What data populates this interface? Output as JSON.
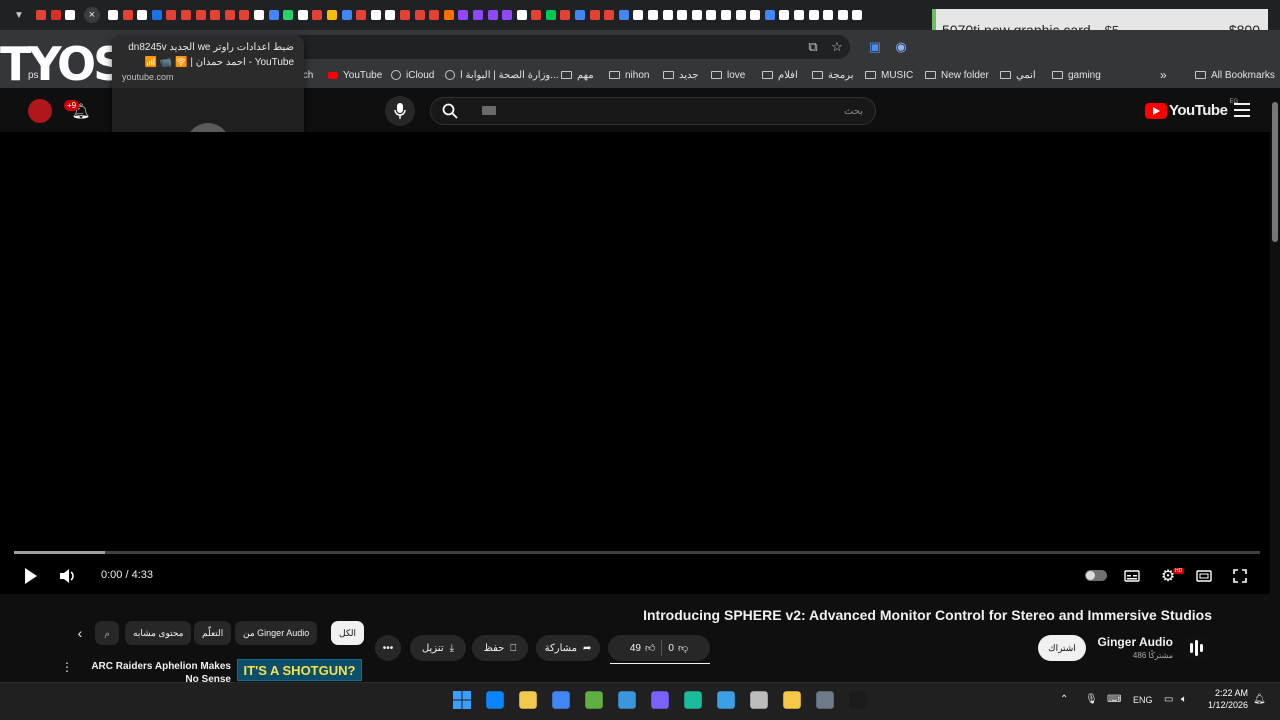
{
  "browser": {
    "tab_favicon_colors": [
      "#e44134",
      "#d93025",
      "#ffffff",
      "#ffffff",
      "#e44134",
      "#ffffff",
      "#1a73e8",
      "#e44134",
      "#e44134",
      "#e44134",
      "#e44134",
      "#e44134",
      "#e44134",
      "#ffffff",
      "#4285f4",
      "#25d366",
      "#ffffff",
      "#e44134",
      "#fbbc04",
      "#4285f4",
      "#e44134",
      "#ffffff",
      "#ffffff",
      "#e44134",
      "#e44134",
      "#e44134",
      "#ff6f00",
      "#9146ff",
      "#9146ff",
      "#9146ff",
      "#9146ff",
      "#ffffff",
      "#e44134",
      "#00c853",
      "#e44134",
      "#4285f4",
      "#e44134",
      "#e44134",
      "#4285f4",
      "#ffffff",
      "#ffffff",
      "#ffffff",
      "#ffffff",
      "#ffffff",
      "#ffffff",
      "#ffffff",
      "#ffffff",
      "#ffffff",
      "#4285f4",
      "#ffffff",
      "#ffffff",
      "#ffffff",
      "#ffffff",
      "#ffffff",
      "#ffffff"
    ],
    "active_tab_close": "×",
    "hovercard": {
      "title": "ضبط اعدادات راوتر we الجديد dn8245v YouTube - احمد حمدان | 🛜 📹 📶",
      "domain": "youtube.com"
    },
    "bookmarks": [
      {
        "label": "ps",
        "icon": "apps-icon"
      },
      {
        "label": "tch",
        "icon": "globe"
      },
      {
        "label": "YouTube",
        "icon": "youtube"
      },
      {
        "label": "iCloud",
        "icon": "globe"
      },
      {
        "label": "وزارة الصحة | البوابة ا...",
        "icon": "globe"
      },
      {
        "label": "مهم",
        "icon": "folder"
      },
      {
        "label": "nihon",
        "icon": "folder"
      },
      {
        "label": "جديد",
        "icon": "folder"
      },
      {
        "label": "love",
        "icon": "folder"
      },
      {
        "label": "افلام",
        "icon": "folder"
      },
      {
        "label": "برمجة",
        "icon": "folder"
      },
      {
        "label": "MUSIC",
        "icon": "folder"
      },
      {
        "label": "New folder",
        "icon": "folder"
      },
      {
        "label": "انمي",
        "icon": "folder"
      },
      {
        "label": "gaming",
        "icon": "folder"
      }
    ],
    "more_bookmarks": "»",
    "all_bookmarks": "All Bookmarks"
  },
  "price_widget": {
    "name": "5070ti new graphic card",
    "low": "$5",
    "high": "$800"
  },
  "overlay_logo": "TYOS",
  "youtube": {
    "search_placeholder": "بحث",
    "logo_text": "YouTube",
    "country_code": "EG",
    "notifications_badge": "+9",
    "player": {
      "time": "0:00 / 4:33",
      "progress_buffered": 0.073
    },
    "video_title": "Introducing SPHERE v2: Advanced Monitor Control for Stereo and Immersive Studios",
    "channel": {
      "name": "Ginger Audio",
      "subscribers": "486 مشتركًا",
      "subscribe_label": "اشتراك"
    },
    "actions": {
      "likes": "49",
      "dislikes": "0",
      "share": "مشاركة",
      "save": "حفظ",
      "download": "تنزيل",
      "more": "•••"
    },
    "chips": [
      {
        "label": "الكل",
        "active": true
      },
      {
        "label": "من Ginger Audio",
        "active": false
      },
      {
        "label": "التعلّم",
        "active": false
      },
      {
        "label": "محتوى مشابه",
        "active": false
      },
      {
        "label": "م",
        "active": false
      }
    ],
    "related": {
      "title": "ARC Raiders Aphelion Makes No Sense",
      "thumb_text": "IT'S A SHOTGUN?"
    }
  },
  "taskbar": {
    "lang": "ENG",
    "time": "2:22 AM",
    "date": "1/12/2026",
    "app_colors": [
      "#0a84ff",
      "#f2c94c",
      "#4285f4",
      "#5fb041",
      "#3a96dd",
      "#7b61ff",
      "#1abc9c",
      "#3ca0e6",
      "#bdbdbd",
      "#f7c948",
      "#6e7b8b",
      "#1b1b1b"
    ]
  }
}
